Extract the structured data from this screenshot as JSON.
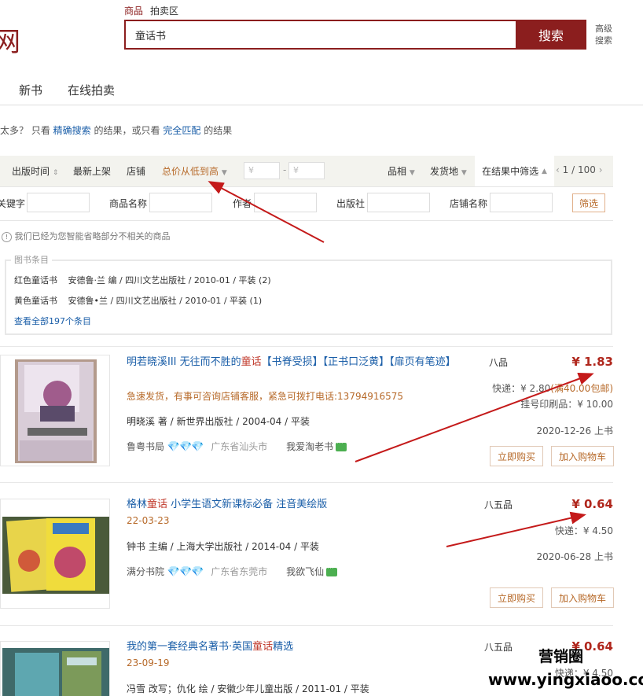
{
  "logo_char": "网",
  "search": {
    "tabs": [
      "商品",
      "拍卖区"
    ],
    "query": "童话书",
    "button": "搜索",
    "advanced_line1": "高级",
    "advanced_line2": "搜索"
  },
  "nav": [
    "新书",
    "在线拍卖"
  ],
  "hint": {
    "pre": "太多？ 只看",
    "link1": "精确搜索",
    "mid": "的结果，或只看",
    "link2": "完全匹配",
    "post": "的结果"
  },
  "filters": {
    "sort_items": [
      "出版时间",
      "最新上架",
      "店铺",
      "总价从低到高"
    ],
    "price_from_placeholder": "¥",
    "price_to_placeholder": "¥",
    "price_dash": "-",
    "right_items": [
      "品相",
      "发货地"
    ],
    "within": "在结果中筛选",
    "pager": "1 / 100",
    "field_labels": [
      "关键字",
      "商品名称",
      "作者",
      "出版社",
      "店铺名称"
    ],
    "filter_button": "筛选"
  },
  "smart_note": "我们已经为您智能省略部分不相关的商品",
  "book_entries": {
    "title": "图书条目",
    "items": [
      {
        "name": "红色童话书",
        "info": "安德鲁·兰 编 / 四川文艺出版社 / 2010-01 / 平装 (2)"
      },
      {
        "name": "黄色童话书",
        "info": "安德鲁•兰 / 四川文艺出版社 / 2010-01 / 平装 (1)"
      }
    ],
    "see_all": "查看全部197个条目"
  },
  "products": [
    {
      "title_pre": "明若晓溪III 无往而不胜的",
      "title_hl": "童话",
      "title_post": "【书脊受损】【正书口泛黄】【扉页有笔迹】",
      "sub": "急速发货，有事可咨询店铺客服，紧急可拨打电话:13794916575",
      "meta": "明晓溪 著 / 新世界出版社 / 2004-04 / 平装",
      "shop": "鲁粤书局",
      "location": "广东省汕头市",
      "seller": "我爱淘老书",
      "grade": "八品",
      "price": "¥ 1.83",
      "shipping": "快递：¥ 2.80",
      "free_ship": "(满40.00包邮)",
      "list_price": "挂号印刷品：¥ 10.00",
      "date": "2020-12-26 上书",
      "buy": "立即购买",
      "cart": "加入购物车"
    },
    {
      "title_pre": "格林",
      "title_hl": "童话",
      "title_post": " 小学生语文新课标必备 注音美绘版",
      "sub": "22-03-23",
      "meta": "钟书 主编 / 上海大学出版社 / 2014-04 / 平装",
      "shop": "满分书院",
      "location": "广东省东莞市",
      "seller": "我欲飞仙",
      "grade": "八五品",
      "price": "¥ 0.64",
      "shipping": "快递：¥ 4.50",
      "date": "2020-06-28 上书",
      "buy": "立即购买",
      "cart": "加入购物车"
    },
    {
      "title_pre": "我的第一套经典名著书·英国",
      "title_hl": "童话",
      "title_post": "精选",
      "sub": "23-09-19",
      "meta": "冯雪 改写；仇化 绘 / 安徽少年儿童出版 / 2011-01 / 平装",
      "grade": "八五品",
      "price": "¥ 0.64",
      "shipping": "快递：¥ 4.50"
    }
  ],
  "watermark": {
    "line1": "营销圈",
    "line2": "www.yingxiaoo.com"
  },
  "colors": {
    "brand": "#8b1e1e",
    "link": "#1a5ea8",
    "price": "#b0271d",
    "accent": "#b76a2a",
    "arrow": "#c41a1a"
  }
}
